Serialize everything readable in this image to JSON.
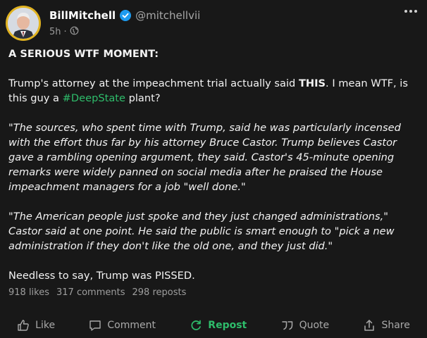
{
  "post": {
    "author_name": "BillMitchell",
    "handle": "@mitchellvii",
    "time": "5h",
    "separator": "·",
    "title": "A SERIOUS WTF MOMENT:",
    "p2_pre": "Trump's attorney at the impeachment trial actually said ",
    "p2_bold": "THIS",
    "p2_mid": ". I mean WTF, is this guy a ",
    "p2_hashtag": "#DeepState",
    "p2_post": " plant?",
    "quote1": "\"The sources, who spent time with Trump, said he was particularly incensed with the effort thus far by his attorney Bruce Castor. Trump believes Castor gave a rambling opening argument, they said. Castor's 45-minute opening remarks were widely panned on social media after he praised the House impeachment managers for a job \"well done.\"",
    "quote2": "\"The American people just spoke and they just changed administrations,\" Castor said at one point. He said the public is smart enough to \"pick a new administration if they don't like the old one, and they just did.\"",
    "closing": "Needless to say, Trump was PISSED."
  },
  "stats": {
    "likes": "918 likes",
    "comments": "317 comments",
    "reposts": "298 reposts"
  },
  "actions": {
    "like": "Like",
    "comment": "Comment",
    "repost": "Repost",
    "quote": "Quote",
    "share": "Share"
  },
  "colors": {
    "background": "#181818",
    "accent_green": "#2ebd6b",
    "verified_blue": "#1d9bf0",
    "avatar_ring": "#e1b321"
  }
}
